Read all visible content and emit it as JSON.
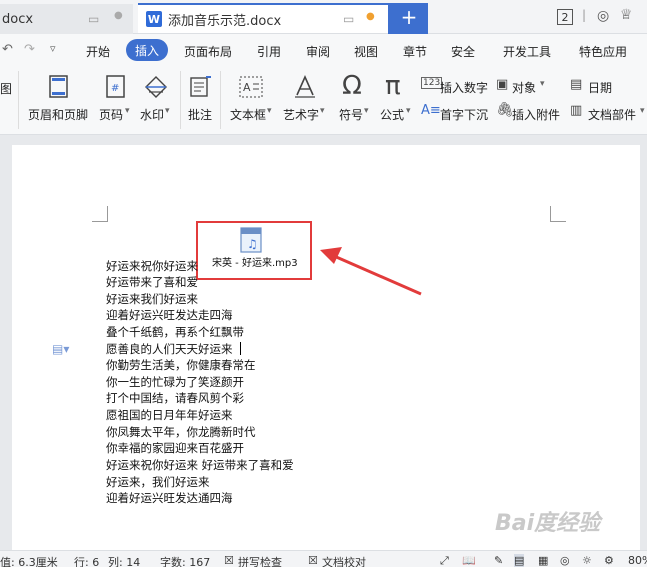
{
  "titlebar": {
    "tab1_label": "docx",
    "tab2_label": "添加音乐示范.docx",
    "tab2_icon": "W",
    "new_tab": "+",
    "badge": "2"
  },
  "menu": {
    "items": [
      "开始",
      "插入",
      "页面布局",
      "引用",
      "审阅",
      "视图",
      "章节",
      "安全",
      "开发工具",
      "特色应用"
    ],
    "active": "插入"
  },
  "ribbon": {
    "tu": "图",
    "header_footer": "页眉和页脚",
    "page_number": "页码",
    "watermark": "水印",
    "comment": "批注",
    "textbox": "文本框",
    "wordart": "艺术字",
    "symbol": "符号",
    "formula": "公式",
    "insert_number": "插入数字",
    "object": "对象",
    "date": "日期",
    "drop_cap": "首字下沉",
    "insert_attachment": "插入附件",
    "doc_parts": "文档部件"
  },
  "document": {
    "attachment_label": "宋英 - 好运来.mp3",
    "lines": [
      "好运来祝你好运来",
      "好运带来了喜和爱",
      "好运来我们好运来",
      "迎着好运兴旺发达走四海",
      "叠个千纸鹤，再系个红飘带",
      "愿善良的人们天天好运来",
      "你勤劳生活美，你健康春常在",
      "你一生的忙碌为了笑逐颜开",
      "打个中国结，请春风剪个彩",
      "愿祖国的日月年年好运来",
      "你凤舞太平年，你龙腾新时代",
      "你幸福的家园迎来百花盛开",
      "好运来祝你好运来    好运带来了喜和爱",
      "好运来，我们好运来",
      "迎着好运兴旺发达通四海"
    ]
  },
  "status": {
    "position": "值: 6.3厘米",
    "row": "行: 6",
    "col": "列: 14",
    "wordcount": "字数: 167",
    "spellcheck": "拼写检查",
    "doccheck": "文档校对",
    "zoom": "80%"
  },
  "watermark_text": "Bai度经验",
  "colors": {
    "accent": "#3d6fcf",
    "highlight": "#e23b3b"
  }
}
